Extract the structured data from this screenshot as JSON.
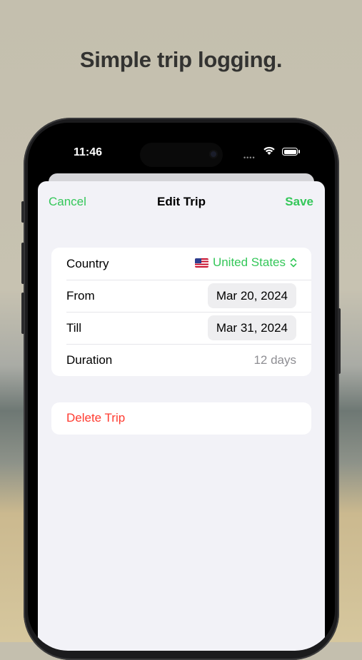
{
  "headline": "Simple trip logging.",
  "status_bar": {
    "time": "11:46",
    "signal_icon": "signal-dots-icon",
    "wifi_icon": "wifi-icon",
    "battery_icon": "battery-icon"
  },
  "nav": {
    "cancel": "Cancel",
    "title": "Edit Trip",
    "save": "Save"
  },
  "form": {
    "country": {
      "label": "Country",
      "flag_icon": "us-flag-icon",
      "value": "United States",
      "chevron_icon": "chevron-up-down-icon"
    },
    "from": {
      "label": "From",
      "value": "Mar 20, 2024"
    },
    "till": {
      "label": "Till",
      "value": "Mar 31, 2024"
    },
    "duration": {
      "label": "Duration",
      "value": "12 days"
    }
  },
  "delete_label": "Delete Trip",
  "colors": {
    "accent": "#34c759",
    "destructive": "#ff3b30",
    "secondary_text": "#8e8e93",
    "sheet_bg": "#f2f2f7"
  }
}
